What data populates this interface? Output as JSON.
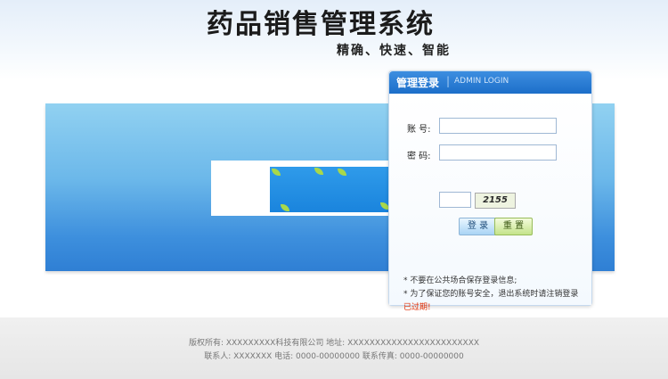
{
  "header": {
    "title": "药品销售管理系统",
    "subtitle": "精确、快速、智能"
  },
  "login": {
    "heading": "管理登录",
    "heading_en": "ADMIN LOGIN",
    "account_label": "账  号:",
    "password_label": "密  码:",
    "account_value": "",
    "password_value": "",
    "captcha_value": "",
    "captcha_image_text": "2155",
    "login_button": "登 录",
    "reset_button": "重 置",
    "notes": [
      "* 不要在公共场合保存登录信息;",
      "* 为了保证您的账号安全，退出系统时请注销登录"
    ],
    "expired": "已过期!"
  },
  "footer": {
    "line1": "版权所有: XXXXXXXXX科技有限公司  地址: XXXXXXXXXXXXXXXXXXXXXXXX",
    "line2": "联系人: XXXXXXX  电话: 0000-00000000  联系传真: 0000-00000000"
  },
  "colors": {
    "banner_top": "#91d1f1",
    "banner_bottom": "#2f7fd4",
    "header_bar": "#1c6ec9",
    "expired_text": "#e02a00"
  }
}
